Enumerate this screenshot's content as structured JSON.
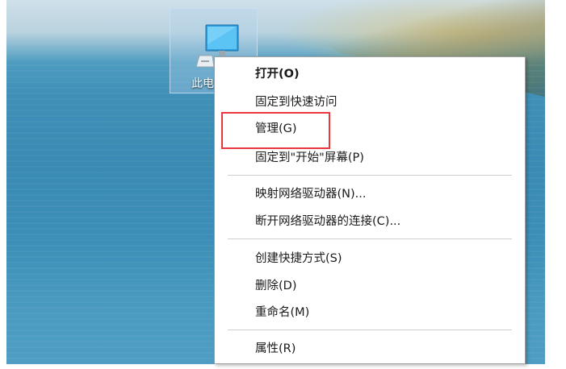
{
  "desktop": {
    "icon_label": "此电脑",
    "icon_name": "this-pc-icon"
  },
  "context_menu": {
    "items": [
      {
        "label": "打开(O)",
        "bold": true
      },
      {
        "label": "固定到快速访问"
      },
      {
        "label": "管理(G)"
      },
      {
        "label": "固定到\"开始\"屏幕(P)"
      },
      {
        "label": "映射网络驱动器(N)..."
      },
      {
        "label": "断开网络驱动器的连接(C)..."
      },
      {
        "label": "创建快捷方式(S)"
      },
      {
        "label": "删除(D)"
      },
      {
        "label": "重命名(M)"
      },
      {
        "label": "属性(R)"
      }
    ]
  },
  "annotation": {
    "highlight_color": "#e8383d",
    "highlighted_item": "管理(G)"
  }
}
